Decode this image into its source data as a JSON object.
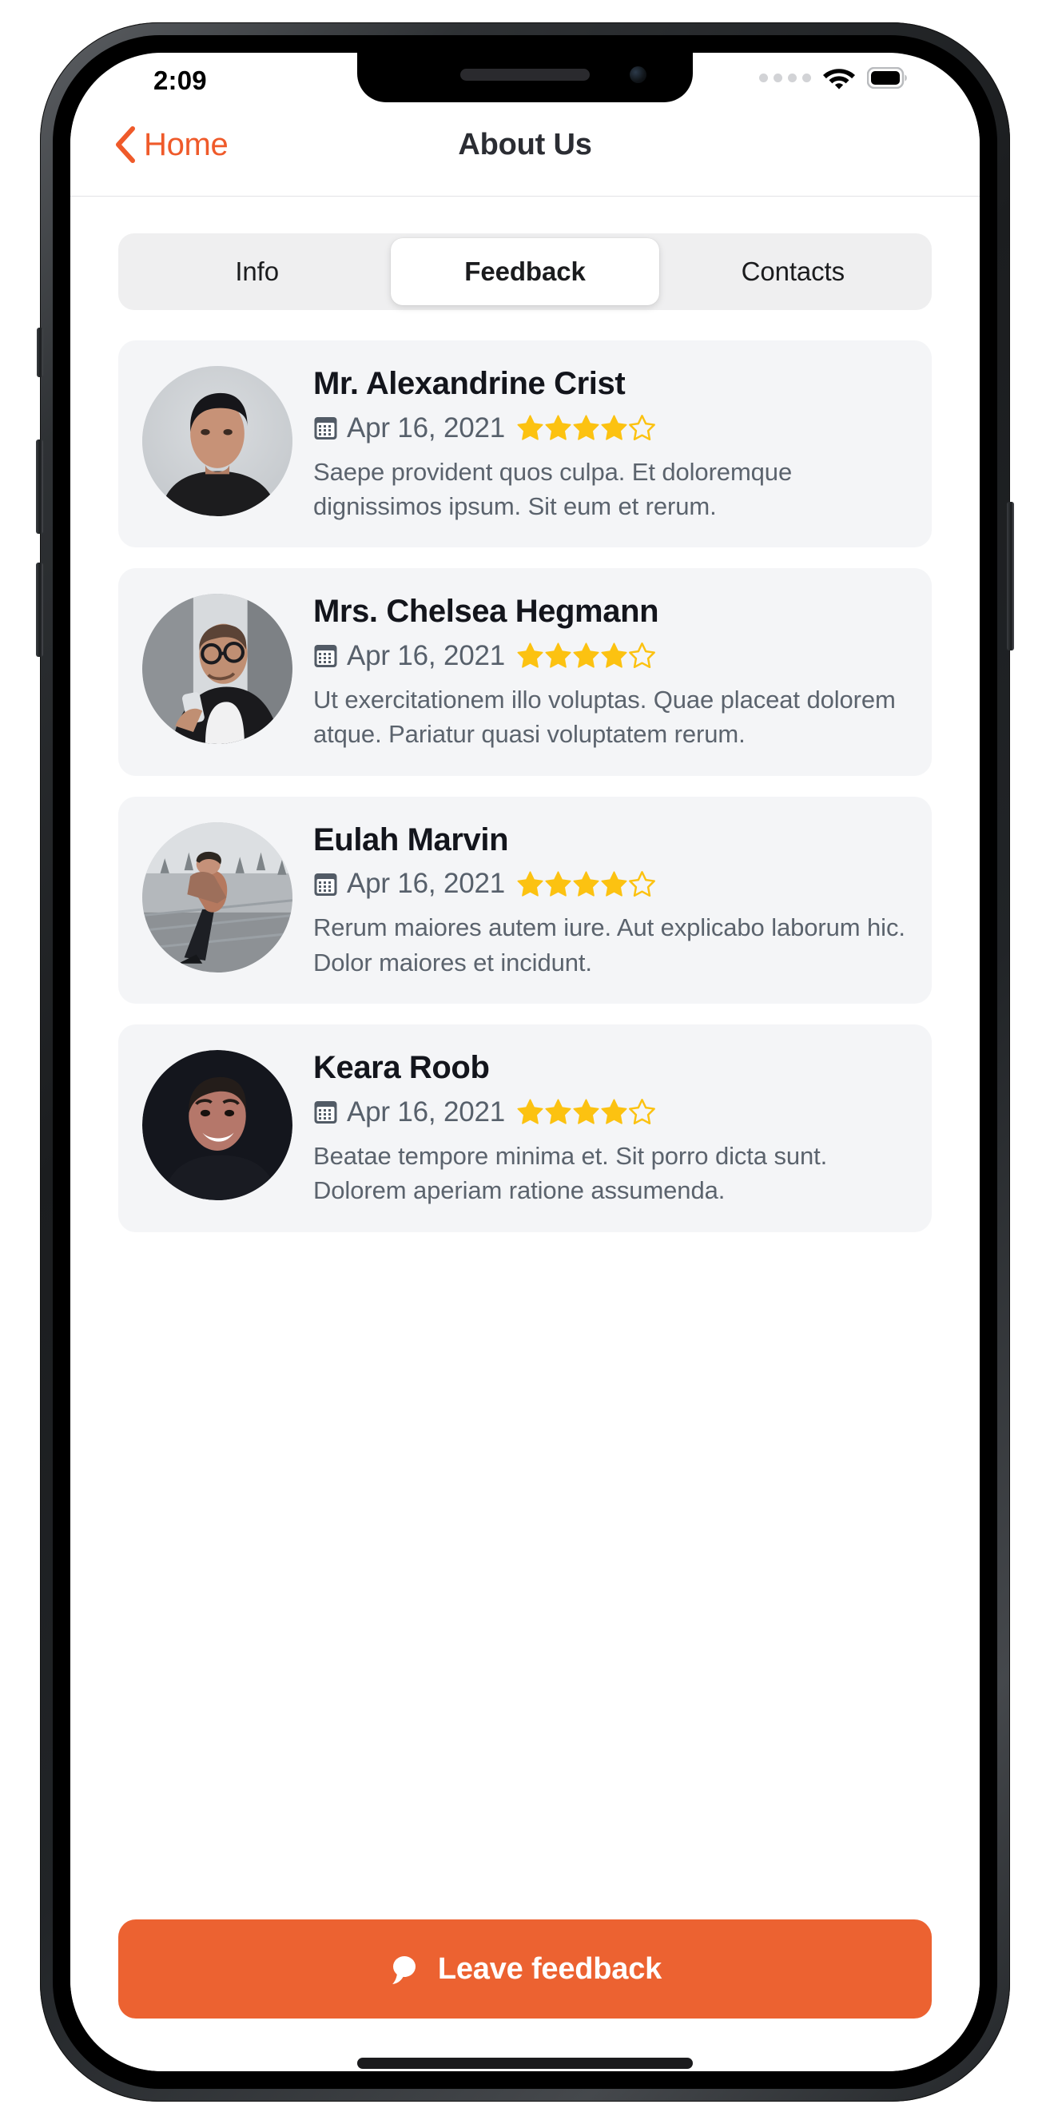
{
  "status_bar": {
    "time": "2:09",
    "signal_icon": "signal-dots-icon",
    "wifi_icon": "wifi-icon",
    "battery_icon": "battery-full-icon"
  },
  "nav_bar": {
    "back_icon": "chevron-left-icon",
    "back_label": "Home",
    "title": "About Us"
  },
  "segmented_control": {
    "selected": "Feedback",
    "segments": [
      {
        "label": "Info",
        "selected": false
      },
      {
        "label": "Feedback",
        "selected": true
      },
      {
        "label": "Contacts",
        "selected": false
      }
    ]
  },
  "feedback": {
    "calendar_icon": "calendar-icon",
    "rating_max": 5,
    "items": [
      {
        "name": "Mr. Alexandrine Crist",
        "date": "Apr 16, 2021",
        "rating": 4,
        "text": "Saepe provident quos culpa. Et doloremque dignissimos ipsum. Sit eum et rerum.",
        "avatar_icon": "avatar-photo-man-dark-shirt"
      },
      {
        "name": "Mrs. Chelsea Hegmann",
        "date": "Apr 16, 2021",
        "rating": 4,
        "text": "Ut exercitationem illo voluptas. Quae placeat dolorem atque. Pariatur quasi voluptatem rerum.",
        "avatar_icon": "avatar-photo-man-glasses-phone"
      },
      {
        "name": "Eulah Marvin",
        "date": "Apr 16, 2021",
        "rating": 4,
        "text": "Rerum maiores autem iure. Aut explicabo laborum hic. Dolor maiores et incidunt.",
        "avatar_icon": "avatar-photo-man-outdoor-railing"
      },
      {
        "name": "Keara Roob",
        "date": "Apr 16, 2021",
        "rating": 4,
        "text": "Beatae tempore minima et. Sit porro dicta sunt. Dolorem aperiam ratione assumenda.",
        "avatar_icon": "avatar-photo-man-smiling-dark"
      }
    ]
  },
  "bottom_action": {
    "icon": "speech-bubble-icon",
    "label": "Leave feedback"
  },
  "colors": {
    "accent_orange": "#EC6231",
    "back_link_orange": "#EF5A2A",
    "star_gold": "#FCC211",
    "card_background": "#F4F5F7",
    "segment_track": "#EFEFF0",
    "title_dark": "#2B2D33",
    "body_gray": "#5B636D"
  }
}
